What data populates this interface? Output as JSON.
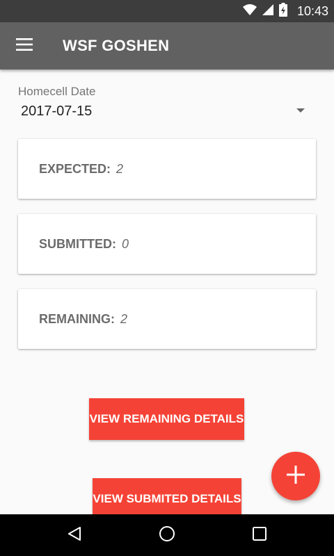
{
  "status_bar": {
    "time": "10:43",
    "icons": [
      "wifi-icon",
      "cell-signal-icon",
      "battery-charging-icon"
    ]
  },
  "app_bar": {
    "title": "WSF GOSHEN",
    "menu_icon": "menu-icon"
  },
  "date_picker": {
    "label": "Homecell Date",
    "value": "2017-07-15"
  },
  "cards": [
    {
      "label": "EXPECTED:",
      "value": "2"
    },
    {
      "label": "SUBMITTED:",
      "value": "0"
    },
    {
      "label": "REMAINING:",
      "value": "2"
    }
  ],
  "buttons": {
    "view_remaining": "VIEW REMAINING DETAILS",
    "view_submitted": "VIEW SUBMITED DETAILS"
  },
  "fab": {
    "icon": "plus-icon"
  },
  "nav": {
    "icons": [
      "back-icon",
      "home-icon",
      "recents-icon"
    ]
  },
  "colors": {
    "accent": "#f44336",
    "app_bar": "#616161",
    "status_bar": "#3d3d3d"
  }
}
